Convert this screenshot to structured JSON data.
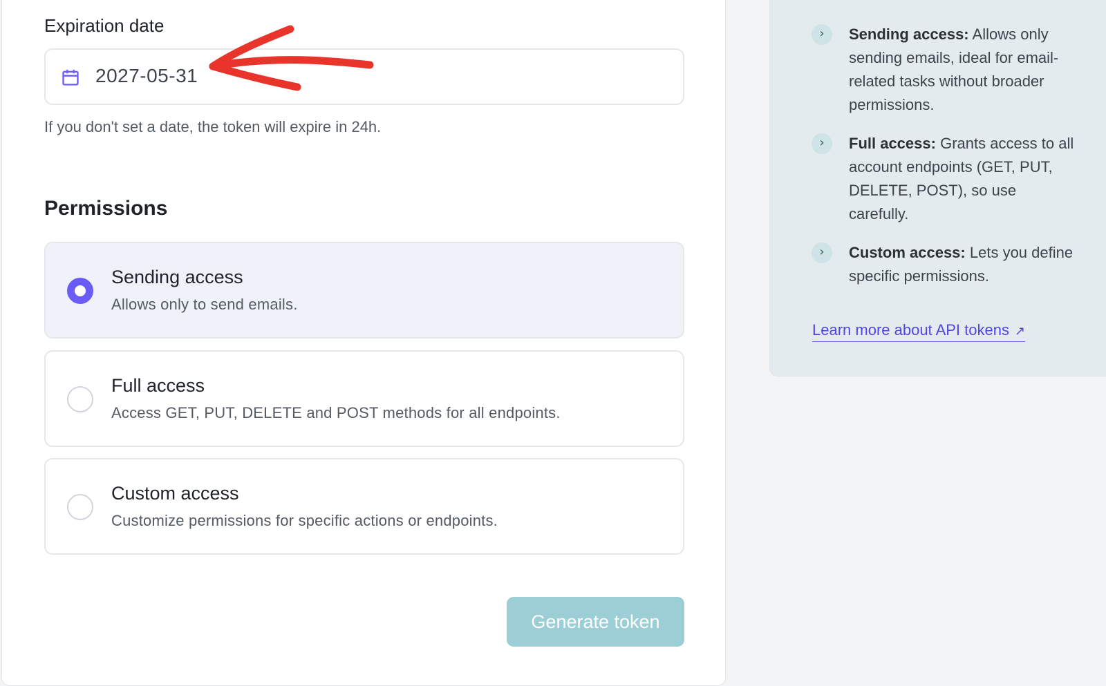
{
  "expiration": {
    "label": "Expiration date",
    "value": "2027-05-31",
    "help": "If you don't set a date, the token will expire in 24h."
  },
  "permissions": {
    "title": "Permissions",
    "options": [
      {
        "title": "Sending access",
        "desc": "Allows only to send emails.",
        "selected": true
      },
      {
        "title": "Full access",
        "desc": "Access GET, PUT, DELETE and POST methods for all endpoints.",
        "selected": false
      },
      {
        "title": "Custom access",
        "desc": "Customize permissions for specific actions or endpoints.",
        "selected": false
      }
    ]
  },
  "generate_button": "Generate token",
  "info": {
    "items": [
      {
        "term": "Sending access:",
        "text": "Allows only sending emails, ideal for email-related tasks without broader permissions."
      },
      {
        "term": "Full access:",
        "text": "Grants access to all account endpoints (GET, PUT, DELETE, POST), so use carefully."
      },
      {
        "term": "Custom access:",
        "text": "Lets you define specific permissions."
      }
    ],
    "link": "Learn more about API tokens"
  },
  "colors": {
    "accent": "#6b5cf6",
    "button": "#9bcfd5",
    "annotation_arrow": "#e8342a",
    "link": "#4f46e5"
  },
  "icons": {
    "calendar": "calendar-icon",
    "chevron": "chevron-right-icon",
    "external": "external-link-icon"
  }
}
